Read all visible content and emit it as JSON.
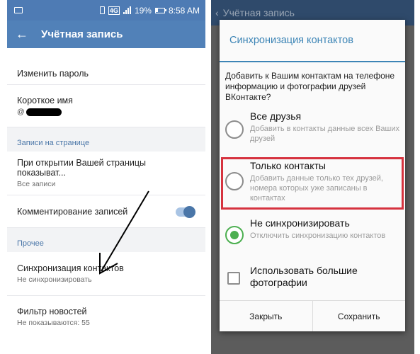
{
  "statusbar": {
    "network": "4G",
    "battery": "19%",
    "time": "8:58 AM"
  },
  "account": {
    "title": "Учётная запись",
    "change_password": "Изменить пароль",
    "short_name_label": "Короткое имя",
    "short_name_prefix": "@",
    "section_wall": "Записи на странице",
    "open_page_title": "При открытии Вашей страницы показыват...",
    "open_page_value": "Все записи",
    "commenting_title": "Комментирование записей",
    "commenting_on": true,
    "section_other": "Прочее",
    "sync_title": "Синхронизация контактов",
    "sync_value": "Не синхронизировать",
    "news_filter_title": "Фильтр новостей",
    "news_filter_value": "Не показываются: 55"
  },
  "dialog": {
    "background_title": "Учётная запись",
    "title": "Синхронизация контактов",
    "message": "Добавить к Вашим контактам на телефоне информацию и фотографии друзей ВКонтакте?",
    "options": [
      {
        "title": "Все друзья",
        "desc": "Добавить в контакты данные всех Ваших друзей",
        "selected": false
      },
      {
        "title": "Только контакты",
        "desc": "Добавить данные только тех друзей, номера которых уже записаны в контактах",
        "selected": false
      },
      {
        "title": "Не синхронизировать",
        "desc": "Отключить синхронизацию контактов",
        "selected": true
      }
    ],
    "large_photos_label": "Использовать большие фотографии",
    "large_photos_checked": false,
    "close_button": "Закрыть",
    "save_button": "Сохранить"
  },
  "colors": {
    "toolbar": "#5181b8",
    "statusbar": "#4e7bb4",
    "accent": "#3d85b6",
    "radio_selected": "#4caf50",
    "highlight": "#d6333f"
  }
}
